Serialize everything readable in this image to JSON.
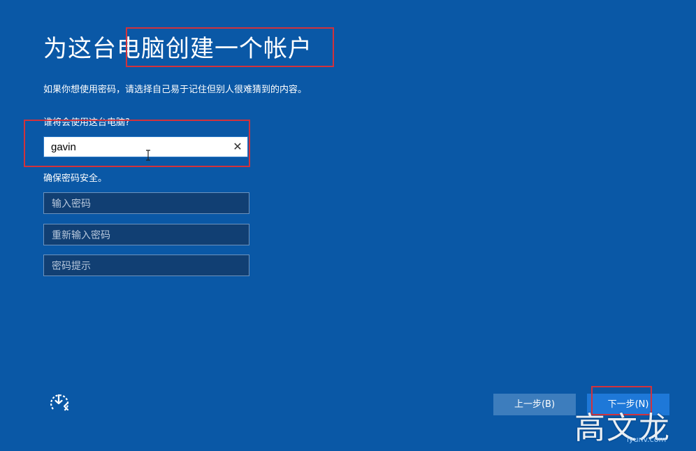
{
  "page": {
    "title": "为这台电脑创建一个帐户",
    "subtitle": "如果你想使用密码，请选择自己易于记住但别人很难猜到的内容。"
  },
  "account": {
    "who_label": "谁将会使用这台电脑?",
    "username_value": "gavin",
    "clear_glyph": "✕"
  },
  "security": {
    "label": "确保密码安全。",
    "password_placeholder": "输入密码",
    "reenter_placeholder": "重新输入密码",
    "hint_placeholder": "密码提示"
  },
  "footer": {
    "accessibility_icon": "ease-of-access-icon",
    "back_label": "上一步(B)",
    "next_label": "下一步(N)"
  },
  "watermark": {
    "text": "高文龙",
    "sub": "iyunv.com"
  },
  "colors": {
    "background": "#0a58a6",
    "highlight_box": "#d2323c",
    "next_button": "#1e78d8",
    "back_button": "#3d7dbd"
  }
}
